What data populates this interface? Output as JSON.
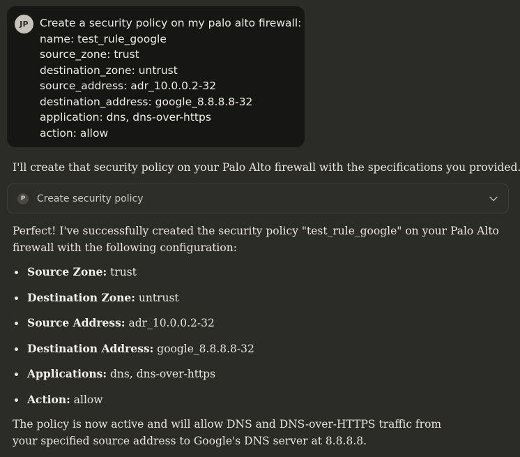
{
  "user_message": {
    "avatar_initials": "JP",
    "lines": [
      "Create a security policy on my palo alto firewall:",
      "name: test_rule_google",
      "source_zone: trust",
      "destination_zone: untrust",
      "source_address: adr_10.0.0.2-32",
      "destination_address: google_8.8.8.8-32",
      "application: dns, dns-over-https",
      "action: allow"
    ]
  },
  "assistant": {
    "intro": "I'll create that security policy on your Palo Alto firewall with the specifications you provided.",
    "tool_call": {
      "icon_letter": "P",
      "label": "Create security policy",
      "icon": "chevron-down-icon"
    },
    "summary": "Perfect! I've successfully created the security policy \"test_rule_google\" on your Palo Alto firewall with the following configuration:",
    "details": [
      {
        "key": "Source Zone:",
        "value": " trust"
      },
      {
        "key": "Destination Zone:",
        "value": " untrust"
      },
      {
        "key": "Source Address:",
        "value": " adr_10.0.0.2-32"
      },
      {
        "key": "Destination Address:",
        "value": " google_8.8.8.8-32"
      },
      {
        "key": "Applications:",
        "value": " dns, dns-over-https"
      },
      {
        "key": "Action:",
        "value": " allow"
      }
    ],
    "closing": "The policy is now active and will allow DNS and DNS-over-HTTPS traffic from your specified source address to Google's DNS server at 8.8.8.8."
  },
  "colors": {
    "background": "#2b2b28",
    "user_bubble": "#161614",
    "text": "#e8e6df"
  }
}
